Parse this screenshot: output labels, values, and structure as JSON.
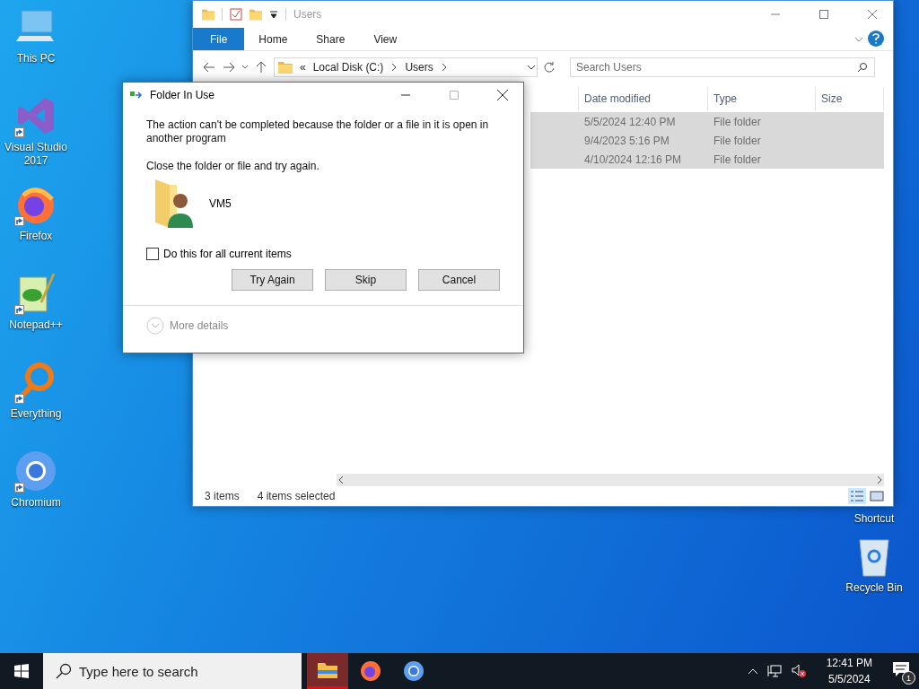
{
  "desktop_icons": [
    {
      "label": "This PC",
      "kind": "pc",
      "shortcut": false
    },
    {
      "label": "Visual Studio 2017",
      "kind": "vs",
      "shortcut": true
    },
    {
      "label": "Firefox",
      "kind": "firefox",
      "shortcut": true
    },
    {
      "label": "Notepad++",
      "kind": "notepad",
      "shortcut": true
    },
    {
      "label": "Everything",
      "kind": "everything",
      "shortcut": true
    },
    {
      "label": "Chromium",
      "kind": "chromium",
      "shortcut": true
    }
  ],
  "right_icons": [
    {
      "label": "Shortcut",
      "kind": "hidden"
    },
    {
      "label": "Recycle Bin",
      "kind": "recycle"
    }
  ],
  "explorer": {
    "title": "Users",
    "ribbon_tabs": [
      {
        "label": "File",
        "kind": "file"
      },
      {
        "label": "Home",
        "kind": "tab"
      },
      {
        "label": "Share",
        "kind": "tab"
      },
      {
        "label": "View",
        "kind": "tab"
      }
    ],
    "breadcrumb_overflow": "«",
    "breadcrumb": [
      "Local Disk (C:)",
      "Users"
    ],
    "search": {
      "placeholder": "Search Users"
    },
    "columns": [
      "Date modified",
      "Type",
      "Size"
    ],
    "rows": [
      {
        "date_modified": "5/5/2024 12:40 PM",
        "type": "File folder",
        "selected": true
      },
      {
        "date_modified": "9/4/2023 5:16 PM",
        "type": "File folder",
        "selected": true
      },
      {
        "date_modified": "4/10/2024 12:16 PM",
        "type": "File folder",
        "selected": true
      }
    ],
    "status": [
      "3 items",
      "4 items selected"
    ]
  },
  "dialog": {
    "title": "Folder In Use",
    "maximize": {
      "disabled": true
    },
    "message": "The action can't be completed because the folder or a file in it is open in another program",
    "hint": "Close the folder or file and try again.",
    "item_name": "VM5",
    "checkbox": {
      "label": "Do this for all current items",
      "checked": false
    },
    "buttons": [
      "Try Again",
      "Skip",
      "Cancel"
    ],
    "more_details": "More details"
  },
  "taskbar": {
    "search": {
      "placeholder": "Type here to search"
    },
    "apps": [
      {
        "kind": "explorer",
        "selected": true
      },
      {
        "kind": "firefox",
        "selected": false
      },
      {
        "kind": "chromium",
        "selected": false
      }
    ],
    "time": "12:41 PM",
    "date": "5/5/2024",
    "notification_count": "1"
  }
}
